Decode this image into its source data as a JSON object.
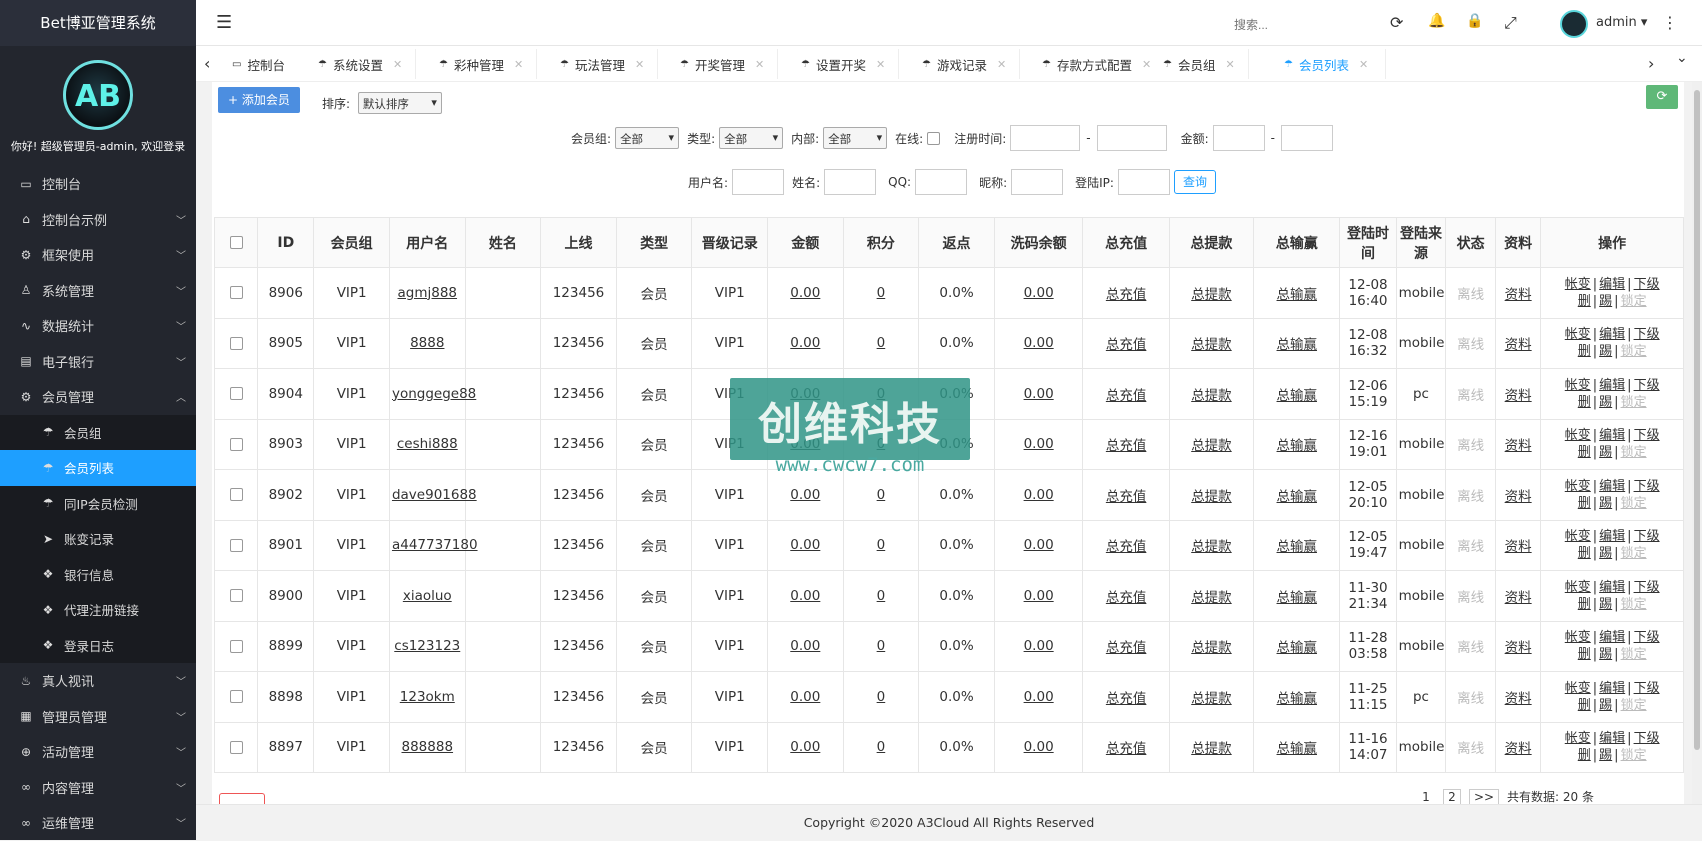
{
  "sidebar": {
    "title": "Bet博亚管理系统",
    "logo_text": "AB",
    "welcome": "你好! 超级管理员-admin, 欢迎登录",
    "items": [
      {
        "label": "控制台",
        "icon": "monitor-icon",
        "chev": ""
      },
      {
        "label": "控制台示例",
        "icon": "home-icon",
        "chev": "﹀"
      },
      {
        "label": "框架使用",
        "icon": "gear-icon",
        "chev": "﹀"
      },
      {
        "label": "系统管理",
        "icon": "user-icon",
        "chev": "﹀"
      },
      {
        "label": "数据统计",
        "icon": "chart-icon",
        "chev": "﹀"
      },
      {
        "label": "电子银行",
        "icon": "book-icon",
        "chev": "﹀"
      },
      {
        "label": "会员管理",
        "icon": "gear-icon",
        "chev": "︿"
      }
    ],
    "sub_items": [
      {
        "label": "会员组",
        "icon": "umbrella-icon"
      },
      {
        "label": "会员列表",
        "icon": "umbrella-icon"
      },
      {
        "label": "同IP会员检测",
        "icon": "umbrella-icon"
      },
      {
        "label": "账变记录",
        "icon": "send-icon"
      },
      {
        "label": "银行信息",
        "icon": "cubes-icon"
      },
      {
        "label": "代理注册链接",
        "icon": "cubes-icon"
      },
      {
        "label": "登录日志",
        "icon": "cubes-icon"
      }
    ],
    "items_after": [
      {
        "label": "真人视讯",
        "icon": "fire-icon",
        "chev": "﹀"
      },
      {
        "label": "管理员管理",
        "icon": "grid-icon",
        "chev": "﹀"
      },
      {
        "label": "活动管理",
        "icon": "plus-circle-icon",
        "chev": "﹀"
      },
      {
        "label": "内容管理",
        "icon": "link-icon",
        "chev": "﹀"
      },
      {
        "label": "运维管理",
        "icon": "link-icon",
        "chev": "﹀"
      }
    ]
  },
  "topbar": {
    "search_placeholder": "搜索...",
    "user": "admin ▾",
    "menu_glyph": "☰",
    "refresh_glyph": "⟳",
    "bell_glyph": "🔔",
    "lock_glyph": "🔒",
    "fullscreen_glyph": "⤢",
    "more_glyph": "⋮"
  },
  "tabs": {
    "left_arrow": "‹",
    "right_arrow": "›",
    "dropdown": "⌄",
    "items": [
      {
        "label": "控制台",
        "icon": "▭",
        "close": ""
      },
      {
        "label": "系统设置",
        "icon": "☂",
        "close": "✕"
      },
      {
        "label": "彩种管理",
        "icon": "☂",
        "close": "✕"
      },
      {
        "label": "玩法管理",
        "icon": "☂",
        "close": "✕"
      },
      {
        "label": "开奖管理",
        "icon": "☂",
        "close": "✕"
      },
      {
        "label": "设置开奖",
        "icon": "☂",
        "close": "✕"
      },
      {
        "label": "游戏记录",
        "icon": "☂",
        "close": "✕"
      },
      {
        "label": "存款方式配置",
        "icon": "☂",
        "close": "✕"
      },
      {
        "label": "会员组",
        "icon": "☂",
        "close": "✕"
      },
      {
        "label": "会员列表",
        "icon": "☂",
        "close": "✕"
      }
    ]
  },
  "toolbar": {
    "add_label": "+ 添加会员",
    "sort_label": "排序:",
    "sort_value": "默认排序",
    "refresh_glyph": "⟳"
  },
  "filters": {
    "group_label": "会员组:",
    "group_value": "全部",
    "type_label": "类型:",
    "type_value": "全部",
    "internal_label": "内部:",
    "internal_value": "全部",
    "online_label": "在线:",
    "regtime_label": "注册时间:",
    "dash": "-",
    "amount_label": "金额:",
    "username_label": "用户名:",
    "name_label": "姓名:",
    "qq_label": "QQ:",
    "nickname_label": "昵称:",
    "loginip_label": "登陆IP:",
    "query_label": "查询"
  },
  "table": {
    "headers": [
      "ID",
      "会员组",
      "用户名",
      "姓名",
      "上线",
      "类型",
      "晋级记录",
      "金额",
      "积分",
      "返点",
      "洗码余额",
      "总充值",
      "总提款",
      "总输赢",
      "登陆时间",
      "登陆来源",
      "状态",
      "资料",
      "操作"
    ],
    "rows": [
      [
        "8906",
        "VIP1",
        "agmj888",
        "",
        "123456",
        "会员",
        "VIP1",
        "0.00",
        "0",
        "0.0%",
        "0.00",
        "总充值",
        "总提款",
        "总输赢",
        "12-08 16:40",
        "mobile",
        "离线",
        "资料"
      ],
      [
        "8905",
        "VIP1",
        "8888",
        "",
        "123456",
        "会员",
        "VIP1",
        "0.00",
        "0",
        "0.0%",
        "0.00",
        "总充值",
        "总提款",
        "总输赢",
        "12-08 16:32",
        "mobile",
        "离线",
        "资料"
      ],
      [
        "8904",
        "VIP1",
        "yonggege88",
        "",
        "123456",
        "会员",
        "VIP1",
        "0.00",
        "0",
        "0.0%",
        "0.00",
        "总充值",
        "总提款",
        "总输赢",
        "12-06 15:19",
        "pc",
        "离线",
        "资料"
      ],
      [
        "8903",
        "VIP1",
        "ceshi888",
        "",
        "123456",
        "会员",
        "VIP1",
        "0.00",
        "0",
        "0.0%",
        "0.00",
        "总充值",
        "总提款",
        "总输赢",
        "12-16 19:01",
        "mobile",
        "离线",
        "资料"
      ],
      [
        "8902",
        "VIP1",
        "dave901688",
        "",
        "123456",
        "会员",
        "VIP1",
        "0.00",
        "0",
        "0.0%",
        "0.00",
        "总充值",
        "总提款",
        "总输赢",
        "12-05 20:10",
        "mobile",
        "离线",
        "资料"
      ],
      [
        "8901",
        "VIP1",
        "a447737180",
        "",
        "123456",
        "会员",
        "VIP1",
        "0.00",
        "0",
        "0.0%",
        "0.00",
        "总充值",
        "总提款",
        "总输赢",
        "12-05 19:47",
        "mobile",
        "离线",
        "资料"
      ],
      [
        "8900",
        "VIP1",
        "xiaoluo",
        "",
        "123456",
        "会员",
        "VIP1",
        "0.00",
        "0",
        "0.0%",
        "0.00",
        "总充值",
        "总提款",
        "总输赢",
        "11-30 21:34",
        "mobile",
        "离线",
        "资料"
      ],
      [
        "8899",
        "VIP1",
        "cs123123",
        "",
        "123456",
        "会员",
        "VIP1",
        "0.00",
        "0",
        "0.0%",
        "0.00",
        "总充值",
        "总提款",
        "总输赢",
        "11-28 03:58",
        "mobile",
        "离线",
        "资料"
      ],
      [
        "8898",
        "VIP1",
        "123okm",
        "",
        "123456",
        "会员",
        "VIP1",
        "0.00",
        "0",
        "0.0%",
        "0.00",
        "总充值",
        "总提款",
        "总输赢",
        "11-25 11:15",
        "pc",
        "离线",
        "资料"
      ],
      [
        "8897",
        "VIP1",
        "888888",
        "",
        "123456",
        "会员",
        "VIP1",
        "0.00",
        "0",
        "0.0%",
        "0.00",
        "总充值",
        "总提款",
        "总输赢",
        "11-16 14:07",
        "mobile",
        "离线",
        "资料"
      ]
    ],
    "ops": {
      "a": "帐变",
      "sep": "|",
      "b": "编辑",
      "c": "下级",
      "d": "删",
      "e": "踢",
      "f": "锁定"
    }
  },
  "pager": {
    "p1": "1",
    "p2": "2",
    "next": ">>",
    "total": "共有数据: 20 条"
  },
  "footer": {
    "copyright": "Copyright ©2020 A3Cloud All Rights Reserved"
  },
  "watermark": {
    "text": "创维科技",
    "url": "www.cwcw7.com"
  }
}
